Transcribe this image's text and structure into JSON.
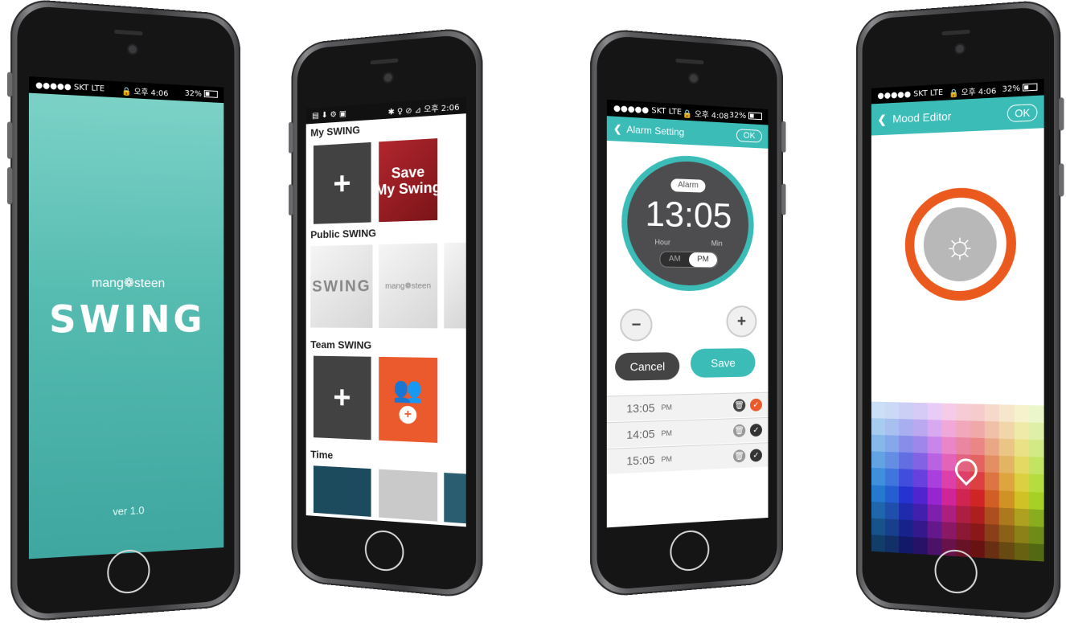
{
  "phone1": {
    "status": {
      "carrier": "●●●●● SKT LTE",
      "time": "🔒 오후 4:06",
      "battery": "32%"
    },
    "brand": "mang❁steen",
    "title": "SWING",
    "version": "ver 1.0"
  },
  "phone2": {
    "status": {
      "left": "▤ ⬇ ⚙ ▣",
      "right": "✱ ♀ ⊘ ⊿ 오후 2:06"
    },
    "sections": [
      "My SWING",
      "Public SWING",
      "Team SWING",
      "Time"
    ],
    "tile_save": "Save\nMy Swing",
    "public_swing": "SWING",
    "public_brand": "mang❁steen",
    "plus": "+"
  },
  "phone3": {
    "status": {
      "carrier": "●●●●● SKT LTE",
      "time": "🔒 오후 4:08",
      "battery": "32%"
    },
    "header_title": "Alarm Setting",
    "ok": "OK",
    "badge": "Alarm",
    "time": "13:05",
    "hour_label": "Hour",
    "min_label": "Min",
    "am": "AM",
    "pm": "PM",
    "minus": "−",
    "plus": "+",
    "cancel": "Cancel",
    "save": "Save",
    "alarms": [
      {
        "time": "13:05",
        "period": "PM",
        "active": true
      },
      {
        "time": "14:05",
        "period": "PM",
        "active": false
      },
      {
        "time": "15:05",
        "period": "PM",
        "active": false
      }
    ]
  },
  "phone4": {
    "status": {
      "carrier": "●●●●● SKT LTE",
      "time": "🔒 오후 4:06",
      "battery": "32%"
    },
    "header_title": "Mood Editor",
    "ok": "OK",
    "accent": "#ea5a1e"
  }
}
